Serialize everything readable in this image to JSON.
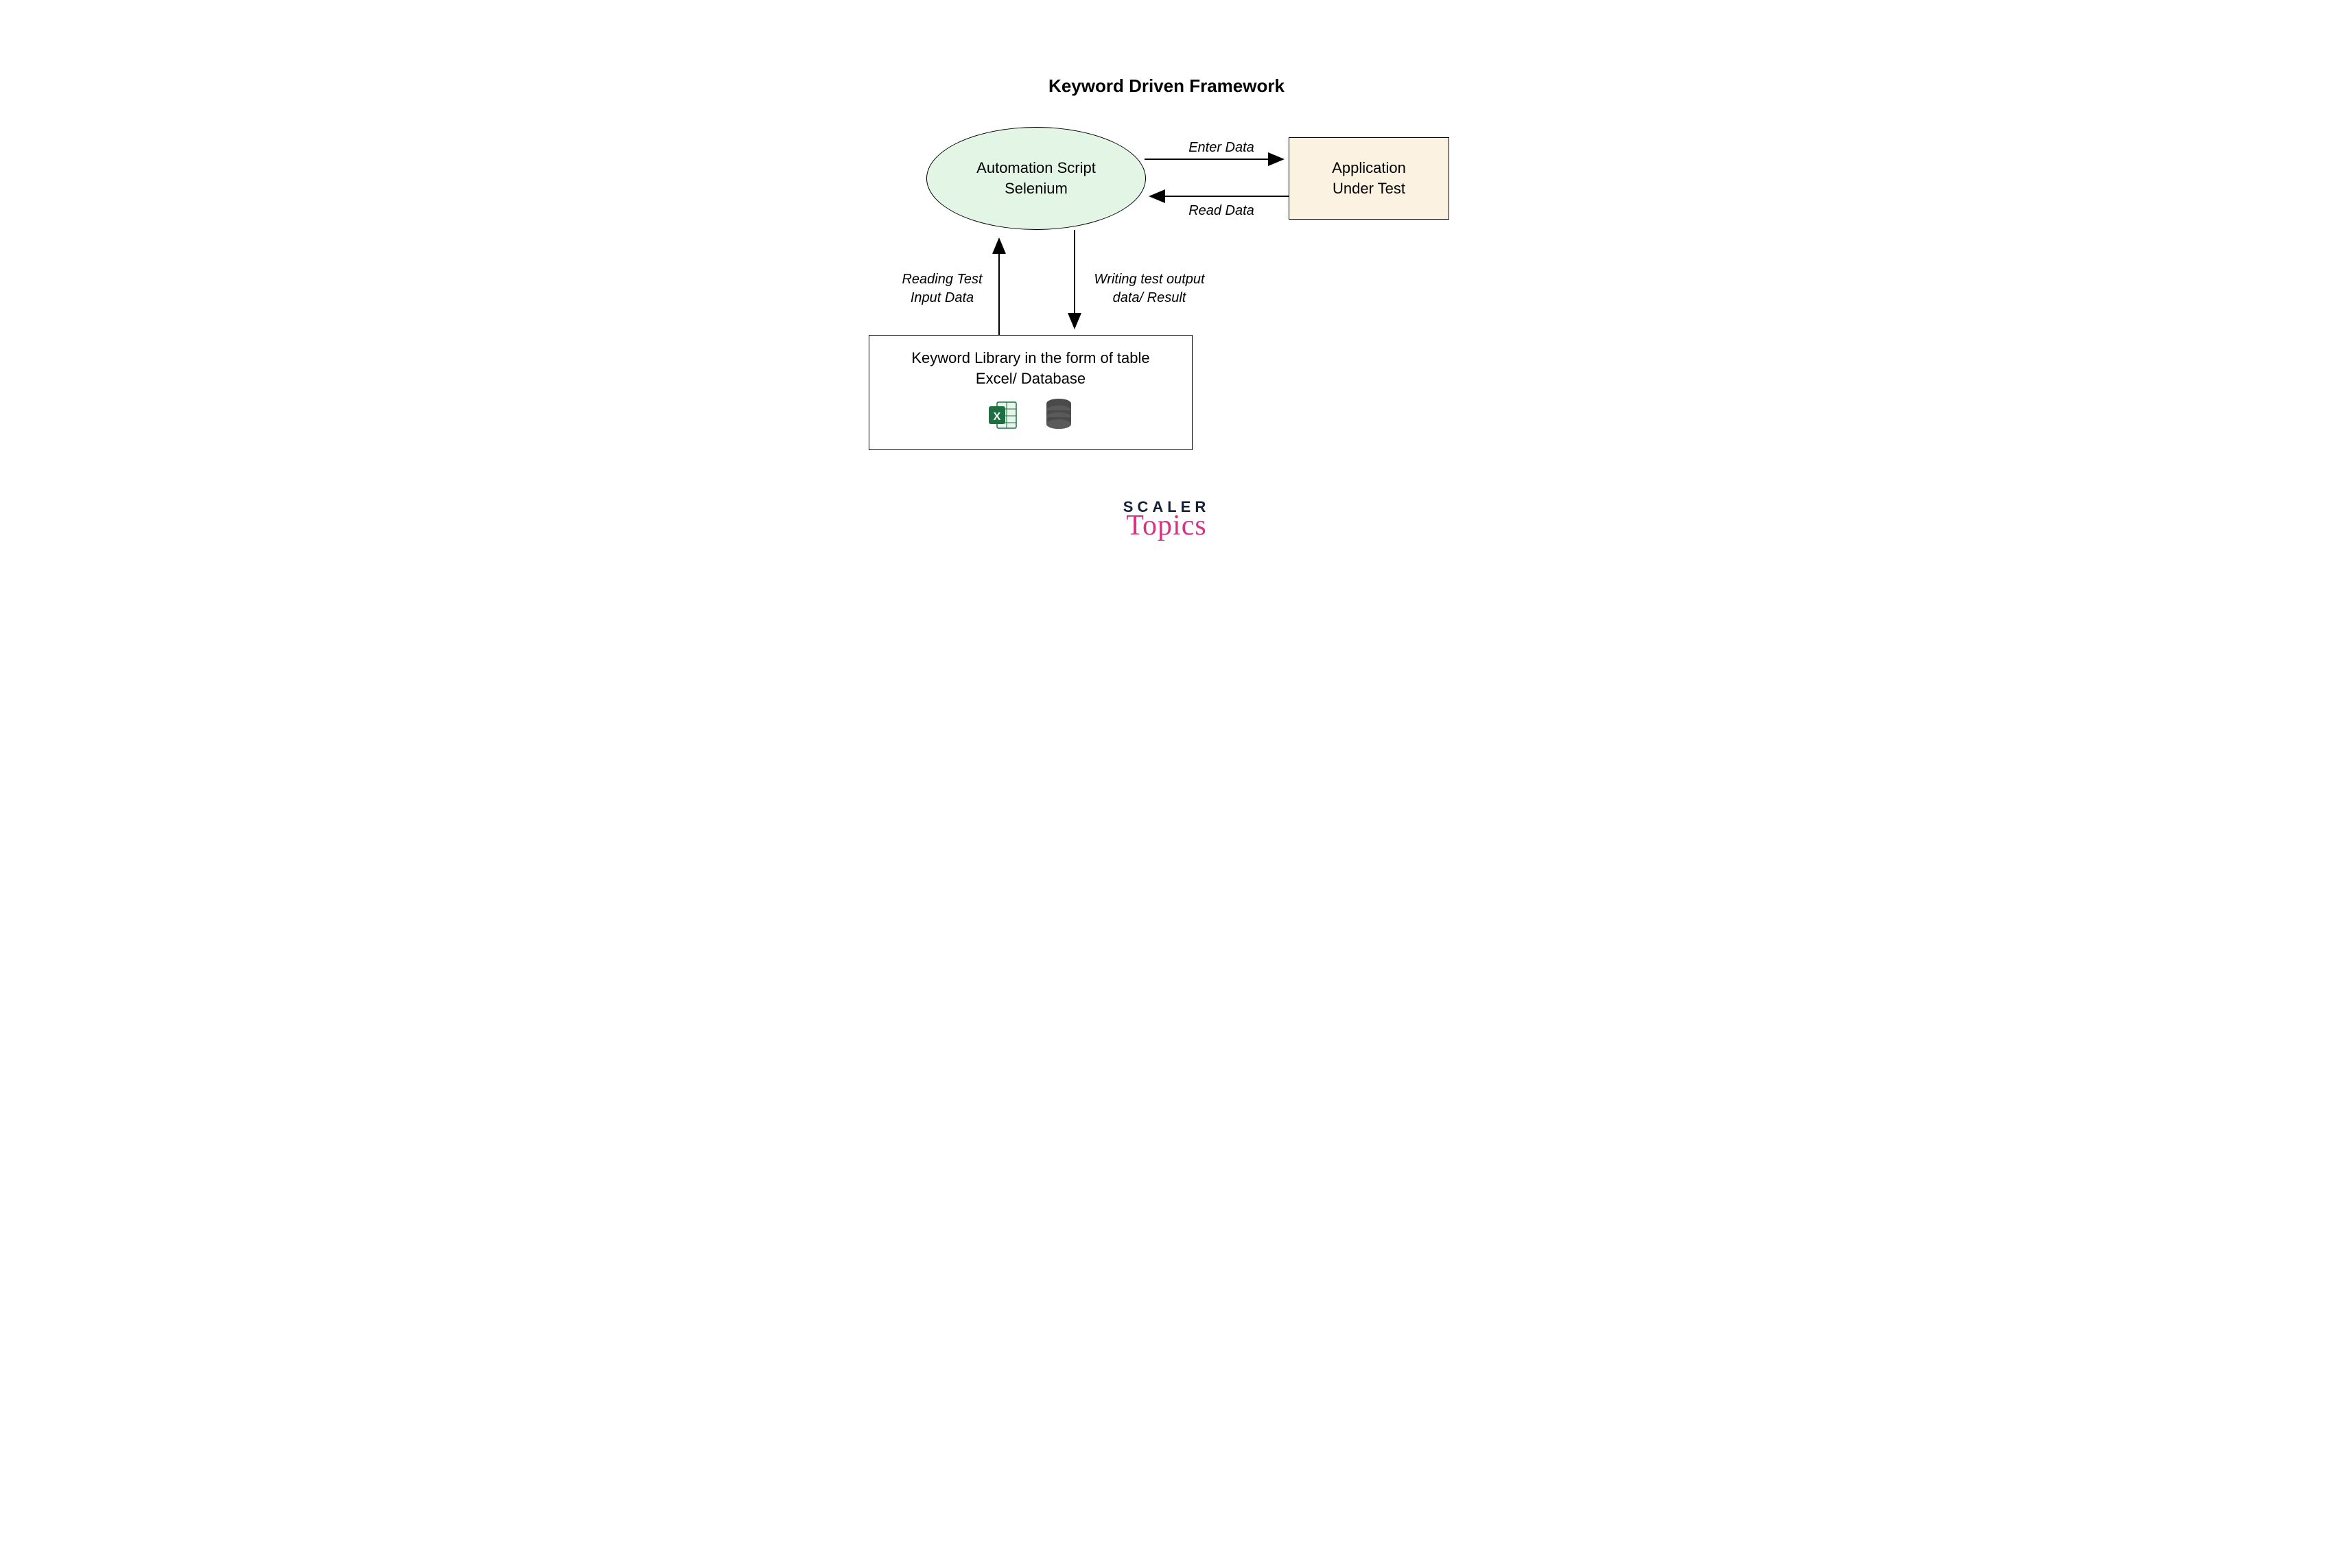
{
  "title": "Keyword Driven Framework",
  "nodes": {
    "automation_script": {
      "line1": "Automation Script",
      "line2": "Selenium",
      "fill": "#e3f5e4"
    },
    "application_under_test": {
      "line1": "Application",
      "line2": "Under Test",
      "fill": "#fbf2e1"
    },
    "keyword_library": {
      "line1": "Keyword Library in the form of table",
      "line2": "Excel/ Database",
      "fill": "#ffffff"
    }
  },
  "edges": {
    "enter_data": "Enter Data",
    "read_data": "Read Data",
    "reading_input": "Reading Test\nInput Data",
    "writing_output": "Writing test output\ndata/ Result"
  },
  "logo": {
    "line1": "SCALER",
    "line2": "Topics"
  }
}
